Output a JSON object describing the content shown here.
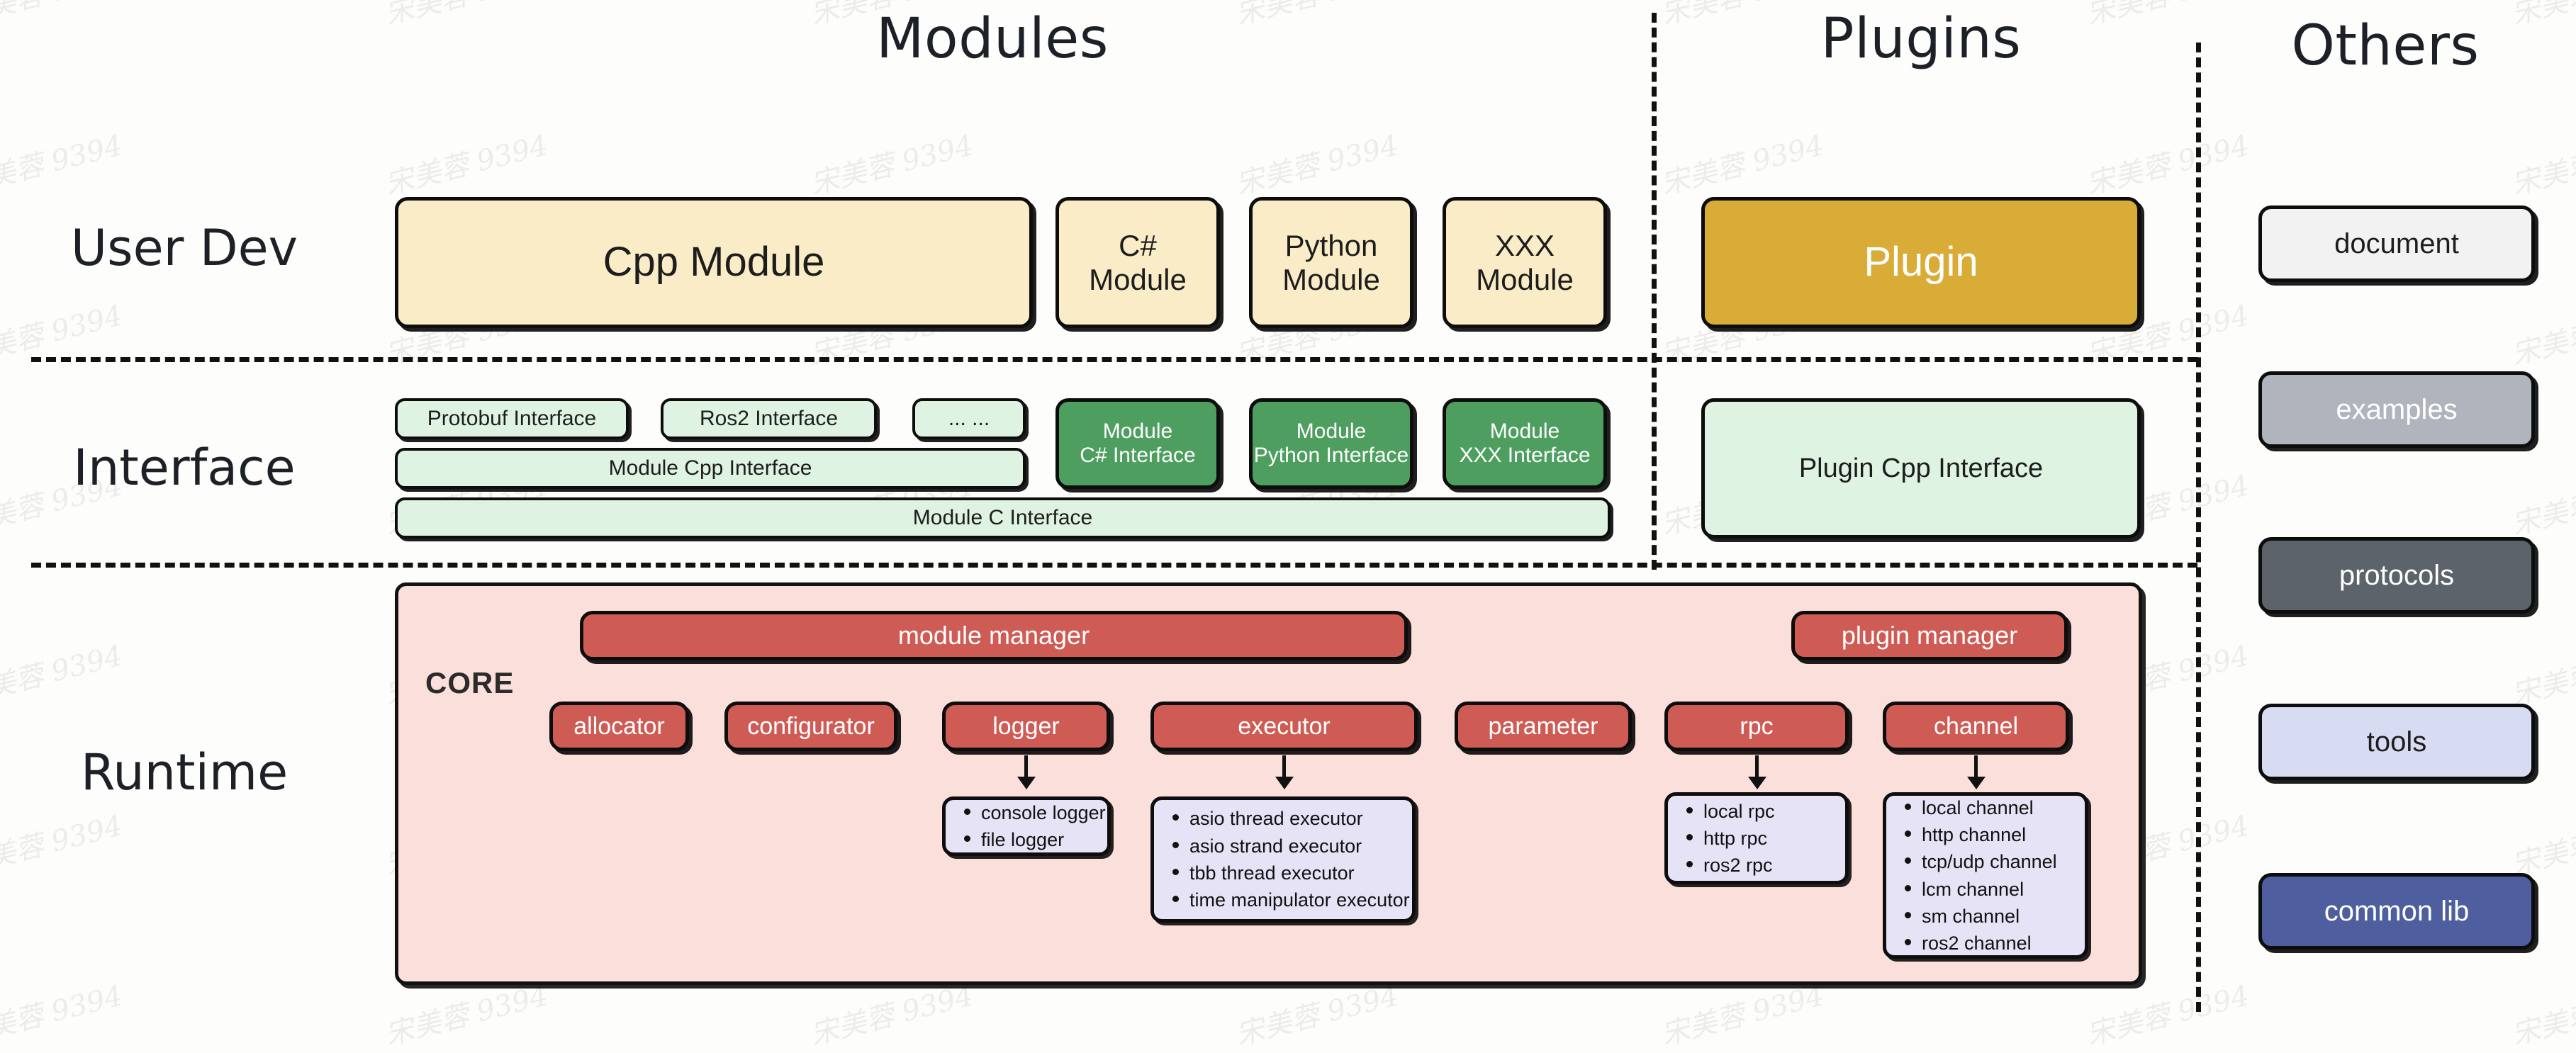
{
  "columns": {
    "modules": "Modules",
    "plugins": "Plugins",
    "others": "Others"
  },
  "rows": {
    "user_dev": "User Dev",
    "interface": "Interface",
    "runtime": "Runtime"
  },
  "user_dev": {
    "cpp_module": "Cpp Module",
    "csharp_module": "C#\nModule",
    "python_module": "Python\nModule",
    "xxx_module": "XXX\nModule",
    "plugin": "Plugin"
  },
  "interface": {
    "protobuf": "Protobuf Interface",
    "ros2": "Ros2 Interface",
    "ellipsis": "... ...",
    "module_cpp": "Module Cpp Interface",
    "module_c": "Module C Interface",
    "module_csharp": "Module\nC# Interface",
    "module_python": "Module\nPython Interface",
    "module_xxx": "Module\nXXX Interface",
    "plugin_cpp": "Plugin Cpp Interface"
  },
  "runtime": {
    "core_label": "CORE",
    "module_manager": "module manager",
    "plugin_manager": "plugin manager",
    "components": [
      "allocator",
      "configurator",
      "logger",
      "executor",
      "parameter",
      "rpc",
      "channel"
    ],
    "logger_items": [
      "console logger",
      "file logger"
    ],
    "executor_items": [
      "asio thread executor",
      "asio strand executor",
      "tbb thread executor",
      "time manipulator executor"
    ],
    "rpc_items": [
      "local rpc",
      "http rpc",
      "ros2 rpc"
    ],
    "channel_items": [
      "local channel",
      "http channel",
      "tcp/udp channel",
      "lcm channel",
      "sm channel",
      "ros2 channel"
    ]
  },
  "others": {
    "items": [
      {
        "label": "document"
      },
      {
        "label": "examples"
      },
      {
        "label": "protocols"
      },
      {
        "label": "tools"
      },
      {
        "label": "common lib"
      }
    ]
  },
  "colors": {
    "module_yellow": "#fbecc8",
    "plugin_gold": "#d9ab37",
    "interface_mint": "#dff3e2",
    "interface_green": "#4d9e5f",
    "core_panel_pink": "#fbdfdb",
    "component_red": "#cf5b55",
    "detail_lavender": "#e6e3f7",
    "document_gray": "#f2f2f2",
    "examples_gray": "#b0b5bd",
    "protocols_gray": "#5d636b",
    "tools_blue": "#d7dcf2",
    "common_lib_blue": "#4f5e9e"
  },
  "watermark": "宋美蓉 9394"
}
